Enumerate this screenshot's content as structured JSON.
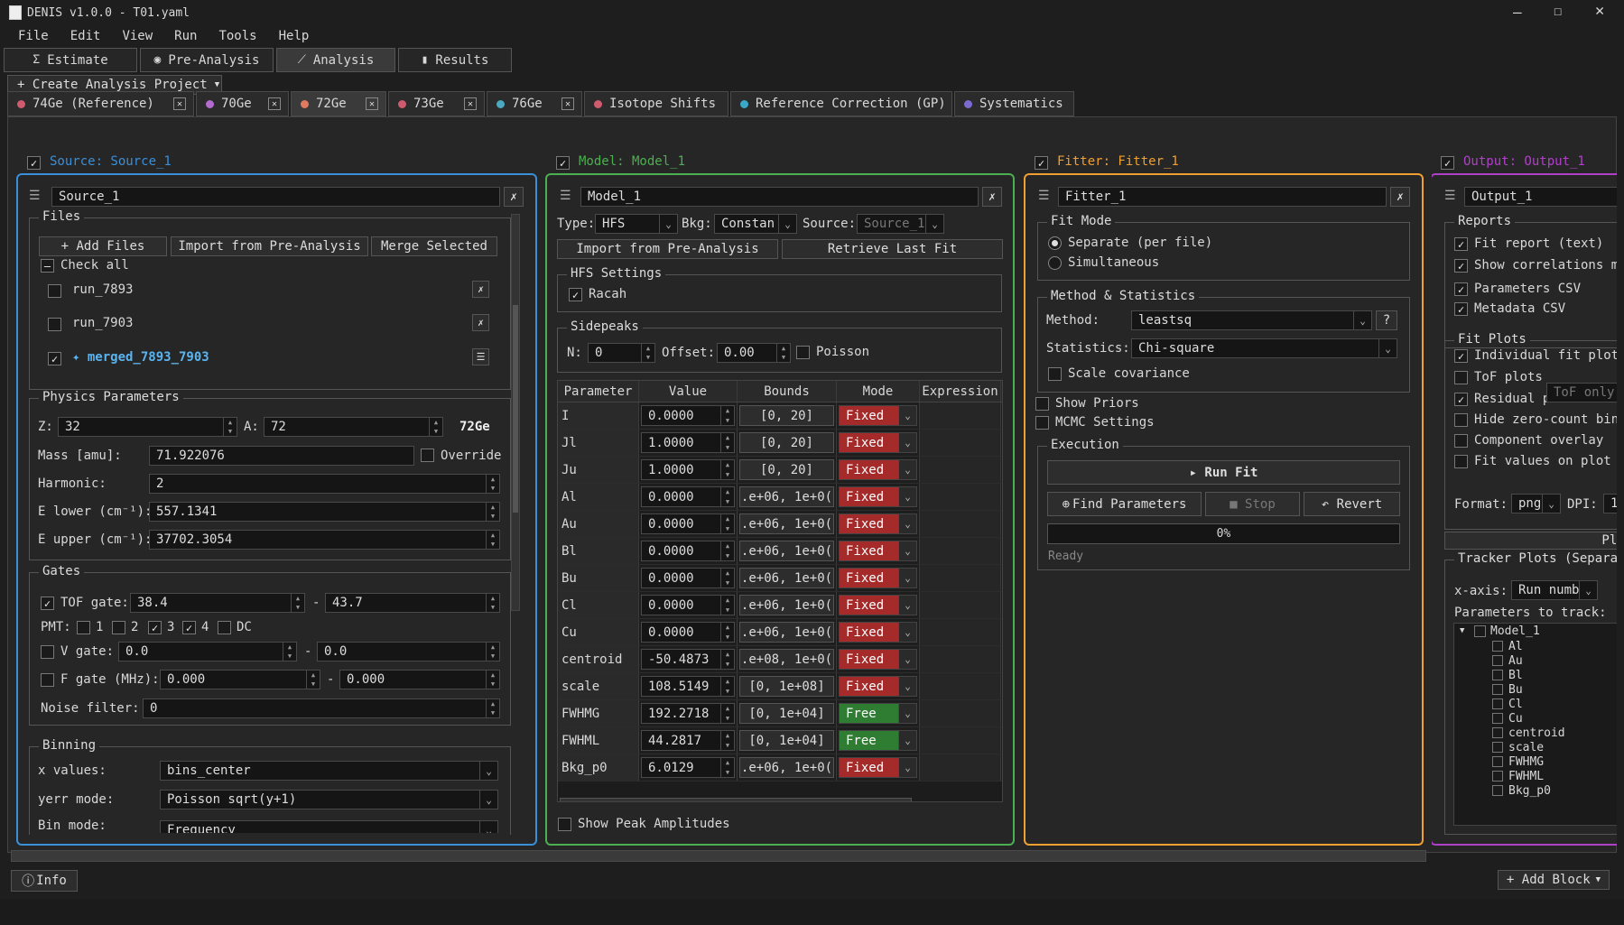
{
  "window": {
    "title": "DENIS v1.0.0 - T01.yaml"
  },
  "menu": [
    "File",
    "Edit",
    "View",
    "Run",
    "Tools",
    "Help"
  ],
  "main_tabs": [
    {
      "label": "Estimate",
      "icon": "sigma-icon"
    },
    {
      "label": "Pre-Analysis",
      "icon": "eye-icon"
    },
    {
      "label": "Analysis",
      "icon": "chart-line-icon"
    },
    {
      "label": "Results",
      "icon": "bar-chart-icon"
    }
  ],
  "create_project": "+ Create Analysis Project",
  "iso_tabs": [
    {
      "label": "74Ge (Reference)",
      "color": "#d05a6e",
      "close": true
    },
    {
      "label": "70Ge",
      "color": "#b36bd0",
      "close": true
    },
    {
      "label": "72Ge",
      "color": "#e07a5f",
      "close": true
    },
    {
      "label": "73Ge",
      "color": "#d05a6e",
      "close": true
    },
    {
      "label": "76Ge",
      "color": "#4aa8c0",
      "close": true
    },
    {
      "label": "Isotope Shifts",
      "color": "#d05a6e",
      "close": false
    },
    {
      "label": "Reference Correction (GP)",
      "color": "#3aa8c8",
      "close": false
    },
    {
      "label": "Systematics",
      "color": "#7a6bd0",
      "close": false
    }
  ],
  "colors": {
    "source": "#3a8fd9",
    "model": "#4caf50",
    "fitter": "#f0a030",
    "output": "#b040c8"
  },
  "source": {
    "header": "Source: Source_1",
    "name": "Source_1",
    "files_title": "Files",
    "add_files": "+ Add Files",
    "import": "Import from Pre-Analysis",
    "merge": "Merge Selected",
    "check_all": "Check all",
    "files": [
      {
        "name": "run_7893",
        "checked": false
      },
      {
        "name": "run_7903",
        "checked": false
      },
      {
        "name": "✦ merged_7893_7903",
        "checked": true
      }
    ],
    "physics_title": "Physics Parameters",
    "z_label": "Z:",
    "z": "32",
    "a_label": "A:",
    "a": "72",
    "iso": "72Ge",
    "mass_label": "Mass [amu]:",
    "mass": "71.922076",
    "override": "Override",
    "harmonic_label": "Harmonic:",
    "harmonic": "2",
    "elower_label": "E lower (cm⁻¹):",
    "elower": "557.1341",
    "eupper_label": "E upper (cm⁻¹):",
    "eupper": "37702.3054",
    "gates_title": "Gates",
    "tof_label": "TOF gate:",
    "tof_min": "38.4",
    "tof_max": "43.7",
    "pmt_label": "PMT:",
    "pmts": [
      {
        "l": "1",
        "c": false
      },
      {
        "l": "2",
        "c": false
      },
      {
        "l": "3",
        "c": true
      },
      {
        "l": "4",
        "c": true
      },
      {
        "l": "DC",
        "c": false
      }
    ],
    "v_label": "V gate:",
    "v_min": "0.0",
    "v_max": "0.0",
    "f_label": "F gate (MHz):",
    "f_min": "0.000",
    "f_max": "0.000",
    "noise_label": "Noise filter:",
    "noise": "0",
    "binning_title": "Binning",
    "xvals_label": "x values:",
    "xvals": "bins_center",
    "yerr_label": "yerr mode:",
    "yerr": "Poisson sqrt(y+1)",
    "binmode_label": "Bin mode:",
    "binmode": "Frequency"
  },
  "model": {
    "header": "Model: Model_1",
    "name": "Model_1",
    "type_label": "Type:",
    "type": "HFS",
    "bkg_label": "Bkg:",
    "bkg": "Constan",
    "src_label": "Source:",
    "src": "Source_1",
    "import": "Import from Pre-Analysis",
    "retrieve": "Retrieve Last Fit",
    "hfs_title": "HFS Settings",
    "racah": "Racah",
    "side_title": "Sidepeaks",
    "n_label": "N:",
    "n": "0",
    "offset_label": "Offset:",
    "offset": "0.00",
    "poisson": "Poisson",
    "cols": [
      "Parameter",
      "Value",
      "Bounds",
      "Mode",
      "Expression"
    ],
    "params": [
      {
        "p": "I",
        "v": "0.0000",
        "b": "[0, 20]",
        "m": "Fixed"
      },
      {
        "p": "Jl",
        "v": "1.0000",
        "b": "[0, 20]",
        "m": "Fixed"
      },
      {
        "p": "Ju",
        "v": "1.0000",
        "b": "[0, 20]",
        "m": "Fixed"
      },
      {
        "p": "Al",
        "v": "0.0000",
        "b": ".e+06, 1e+0(",
        "m": "Fixed"
      },
      {
        "p": "Au",
        "v": "0.0000",
        "b": ".e+06, 1e+0(",
        "m": "Fixed"
      },
      {
        "p": "Bl",
        "v": "0.0000",
        "b": ".e+06, 1e+0(",
        "m": "Fixed"
      },
      {
        "p": "Bu",
        "v": "0.0000",
        "b": ".e+06, 1e+0(",
        "m": "Fixed"
      },
      {
        "p": "Cl",
        "v": "0.0000",
        "b": ".e+06, 1e+0(",
        "m": "Fixed"
      },
      {
        "p": "Cu",
        "v": "0.0000",
        "b": ".e+06, 1e+0(",
        "m": "Fixed"
      },
      {
        "p": "centroid",
        "v": "-50.4873",
        "b": ".e+08, 1e+0(",
        "m": "Fixed"
      },
      {
        "p": "scale",
        "v": "108.5149",
        "b": "[0, 1e+08]",
        "m": "Fixed"
      },
      {
        "p": "FWHMG",
        "v": "192.2718",
        "b": "[0, 1e+04]",
        "m": "Free"
      },
      {
        "p": "FWHML",
        "v": "44.2817",
        "b": "[0, 1e+04]",
        "m": "Free"
      },
      {
        "p": "Bkg_p0",
        "v": "6.0129",
        "b": ".e+06, 1e+0(",
        "m": "Fixed"
      }
    ],
    "show_amps": "Show Peak Amplitudes"
  },
  "fitter": {
    "header": "Fitter: Fitter_1",
    "name": "Fitter_1",
    "mode_title": "Fit Mode",
    "sep": "Separate (per file)",
    "sim": "Simultaneous",
    "method_title": "Method & Statistics",
    "method_label": "Method:",
    "method": "leastsq",
    "help": "?",
    "stats_label": "Statistics:",
    "stats": "Chi-square",
    "scale_cov": "Scale covariance",
    "priors": "Show Priors",
    "mcmc": "MCMC Settings",
    "exec_title": "Execution",
    "run": "▸ Run Fit",
    "find": "Find Parameters",
    "stop": "■ Stop",
    "revert": "↶ Revert",
    "progress": "0%",
    "progress_value": 0,
    "status": "Ready"
  },
  "output": {
    "header": "Output: Output_1",
    "name": "Output_1",
    "reports_title": "Reports",
    "reports": [
      {
        "l": "Fit report (text)",
        "c": true
      },
      {
        "l": "Show correlations m",
        "c": true
      },
      {
        "l": "Parameters CSV",
        "c": true
      },
      {
        "l": "Metadata CSV",
        "c": true
      }
    ],
    "plots_title": "Fit Plots",
    "plots": [
      {
        "l": "Individual fit plot",
        "c": true
      },
      {
        "l": "ToF plots",
        "c": false
      },
      {
        "l": "Residual panel",
        "c": true
      },
      {
        "l": "Hide zero-count bin",
        "c": false
      },
      {
        "l": "Component overlay",
        "c": false
      },
      {
        "l": "Fit values on plot",
        "c": false
      }
    ],
    "tof_only": "ToF only",
    "format_label": "Format:",
    "format": "png",
    "dpi_label": "DPI:",
    "dpi": "1",
    "plot_btn": "Plot C",
    "tracker_title": "Tracker Plots (Separa",
    "xaxis_label": "x-axis:",
    "xaxis": "Run numb",
    "ptt_label": "Parameters to track:",
    "tree_root": "Model_1",
    "tree_items": [
      "Al",
      "Au",
      "Bl",
      "Bu",
      "Cl",
      "Cu",
      "centroid",
      "scale",
      "FWHMG",
      "FWHML",
      "Bkg_p0"
    ]
  },
  "footer": {
    "info": "Info",
    "add_block": "+ Add Block"
  }
}
